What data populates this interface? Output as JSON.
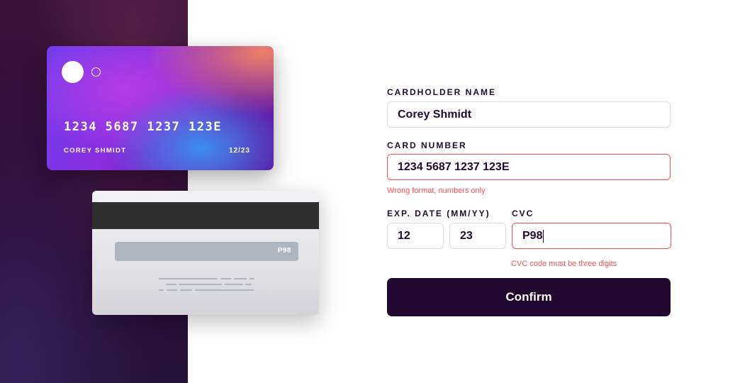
{
  "card_front": {
    "number": "1234 5687 1237 123E",
    "name": "COREY SHMIDT",
    "expiry": "12/23"
  },
  "card_back": {
    "cvc": "P98"
  },
  "form": {
    "cardholder_label": "CARDHOLDER NAME",
    "cardholder_value": "Corey Shmidt",
    "number_label": "CARD NUMBER",
    "number_value": "1234 5687 1237 123E",
    "number_error": "Wrong format, numbers only",
    "exp_label": "EXP. DATE (MM/YY)",
    "exp_month_value": "12",
    "exp_year_value": "23",
    "cvc_label": "CVC",
    "cvc_value": "P98",
    "cvc_error": "CVC code must be three digits",
    "confirm_label": "Confirm"
  },
  "colors": {
    "dark": "#21092f",
    "error": "#ff5050",
    "border": "#dedddf"
  }
}
